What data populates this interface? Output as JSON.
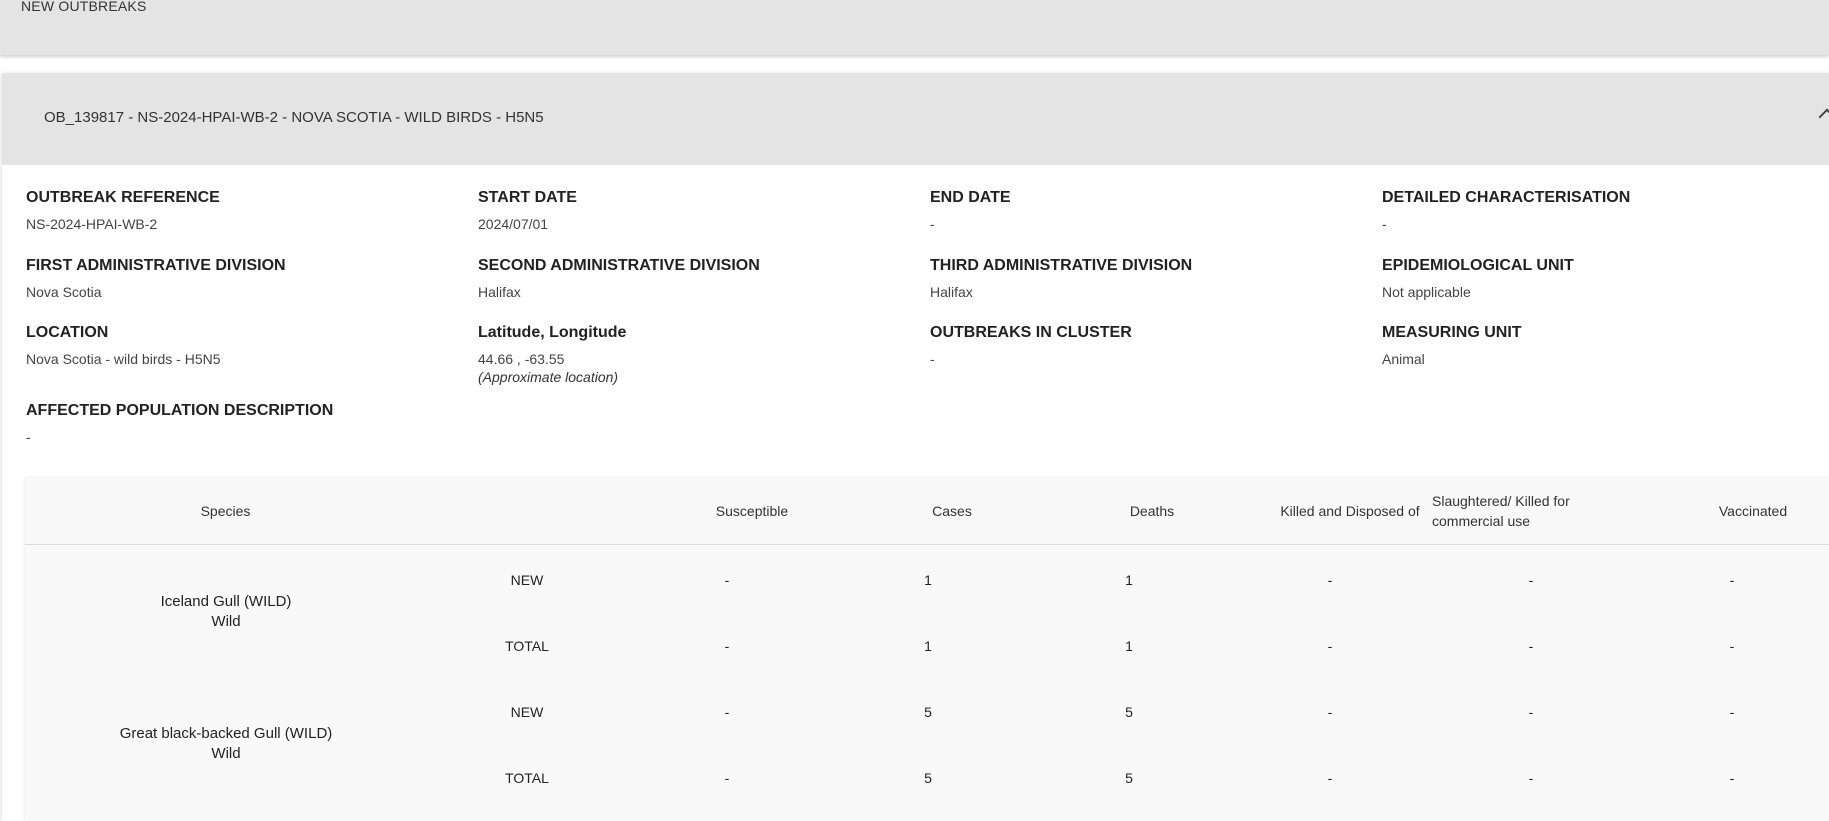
{
  "page": {
    "section_title": "NEW OUTBREAKS"
  },
  "outbreak": {
    "header": "OB_139817 - NS-2024-HPAI-WB-2 - NOVA SCOTIA - WILD BIRDS - H5N5",
    "fields": {
      "outbreak_reference": {
        "label": "OUTBREAK REFERENCE",
        "value": "NS-2024-HPAI-WB-2"
      },
      "start_date": {
        "label": "START DATE",
        "value": "2024/07/01"
      },
      "end_date": {
        "label": "END DATE",
        "value": "-"
      },
      "detailed_characterisation": {
        "label": "DETAILED CHARACTERISATION",
        "value": "-"
      },
      "first_admin_division": {
        "label": "FIRST ADMINISTRATIVE DIVISION",
        "value": "Nova Scotia"
      },
      "second_admin_division": {
        "label": "SECOND ADMINISTRATIVE DIVISION",
        "value": "Halifax"
      },
      "third_admin_division": {
        "label": "THIRD ADMINISTRATIVE DIVISION",
        "value": "Halifax"
      },
      "epidemiological_unit": {
        "label": "EPIDEMIOLOGICAL UNIT",
        "value": "Not applicable"
      },
      "location": {
        "label": "LOCATION",
        "value": "Nova Scotia - wild birds - H5N5"
      },
      "lat_long": {
        "label": "Latitude, Longitude",
        "value": "44.66 , -63.55",
        "note": "(Approximate location)"
      },
      "outbreaks_in_cluster": {
        "label": "OUTBREAKS IN CLUSTER",
        "value": "-"
      },
      "measuring_unit": {
        "label": "MEASURING UNIT",
        "value": "Animal"
      },
      "affected_population": {
        "label": "AFFECTED POPULATION DESCRIPTION",
        "value": "-"
      }
    }
  },
  "table": {
    "headers": [
      "Species",
      "Susceptible",
      "Cases",
      "Deaths",
      "Killed and Disposed of",
      "Slaughtered/ Killed for commercial use",
      "Vaccinated"
    ],
    "species": [
      {
        "name": "Iceland Gull (WILD)",
        "type": "Wild",
        "rows": [
          {
            "kind": "NEW",
            "susceptible": "-",
            "cases": "1",
            "deaths": "1",
            "killed": "-",
            "slaughtered": "-",
            "vaccinated": "-"
          },
          {
            "kind": "TOTAL",
            "susceptible": "-",
            "cases": "1",
            "deaths": "1",
            "killed": "-",
            "slaughtered": "-",
            "vaccinated": "-"
          }
        ]
      },
      {
        "name": "Great black-backed Gull (WILD)",
        "type": "Wild",
        "rows": [
          {
            "kind": "NEW",
            "susceptible": "-",
            "cases": "5",
            "deaths": "5",
            "killed": "-",
            "slaughtered": "-",
            "vaccinated": "-"
          },
          {
            "kind": "TOTAL",
            "susceptible": "-",
            "cases": "5",
            "deaths": "5",
            "killed": "-",
            "slaughtered": "-",
            "vaccinated": "-"
          }
        ]
      }
    ]
  }
}
